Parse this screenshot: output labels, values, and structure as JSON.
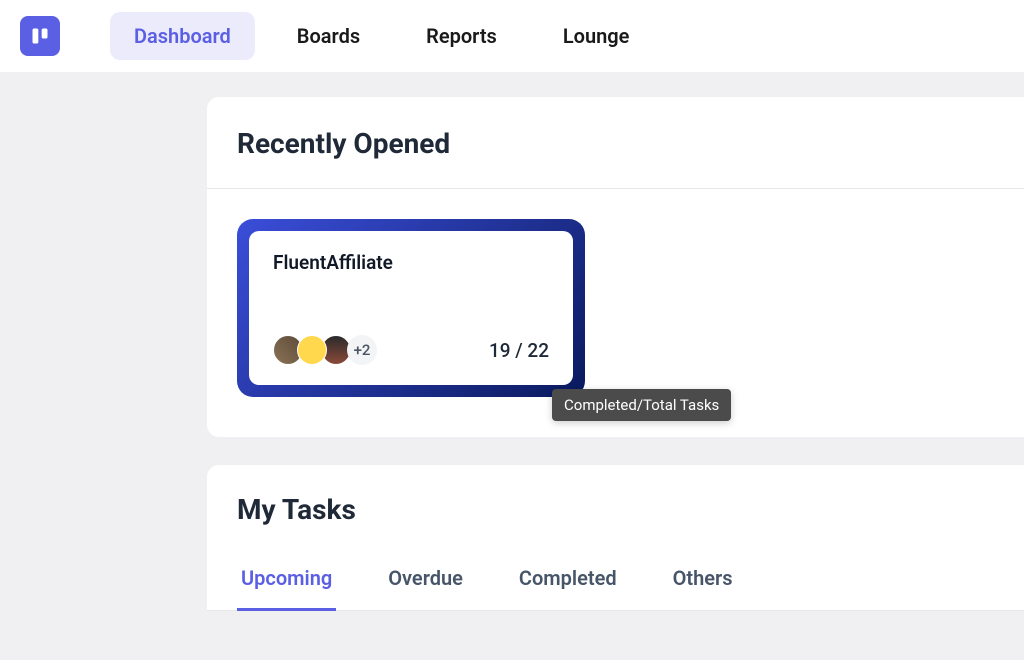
{
  "nav": {
    "items": [
      {
        "label": "Dashboard",
        "active": true
      },
      {
        "label": "Boards",
        "active": false
      },
      {
        "label": "Reports",
        "active": false
      },
      {
        "label": "Lounge",
        "active": false
      }
    ]
  },
  "recently_opened": {
    "title": "Recently Opened",
    "project": {
      "name": "FluentAffiliate",
      "avatar_overflow": "+2",
      "task_count": "19 / 22",
      "tooltip": "Completed/Total Tasks"
    }
  },
  "my_tasks": {
    "title": "My Tasks",
    "tabs": [
      {
        "label": "Upcoming",
        "active": true
      },
      {
        "label": "Overdue",
        "active": false
      },
      {
        "label": "Completed",
        "active": false
      },
      {
        "label": "Others",
        "active": false
      }
    ]
  }
}
